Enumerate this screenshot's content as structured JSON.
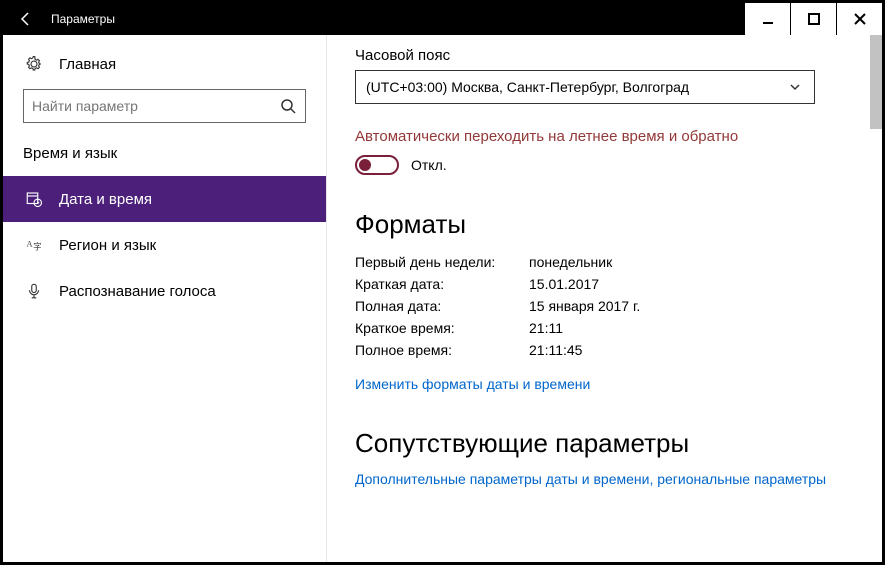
{
  "window": {
    "title": "Параметры"
  },
  "sidebar": {
    "home": "Главная",
    "search_placeholder": "Найти параметр",
    "section_label": "Время и язык",
    "items": [
      {
        "label": "Дата и время"
      },
      {
        "label": "Регион и язык"
      },
      {
        "label": "Распознавание голоса"
      }
    ]
  },
  "main": {
    "timezone_label": "Часовой пояс",
    "timezone_value": "(UTC+03:00) Москва, Санкт-Петербург, Волгоград",
    "dst_label": "Автоматически переходить на летнее время и обратно",
    "dst_state": "Откл.",
    "formats_heading": "Форматы",
    "formats": {
      "first_day_label": "Первый день недели:",
      "first_day_value": "понедельник",
      "short_date_label": "Краткая дата:",
      "short_date_value": "15.01.2017",
      "long_date_label": "Полная дата:",
      "long_date_value": "15 января 2017 г.",
      "short_time_label": "Краткое время:",
      "short_time_value": "21:11",
      "long_time_label": "Полное время:",
      "long_time_value": "21:11:45"
    },
    "change_formats_link": "Изменить форматы даты и времени",
    "related_heading": "Сопутствующие параметры",
    "related_link": "Дополнительные параметры даты и времени, региональные параметры"
  }
}
